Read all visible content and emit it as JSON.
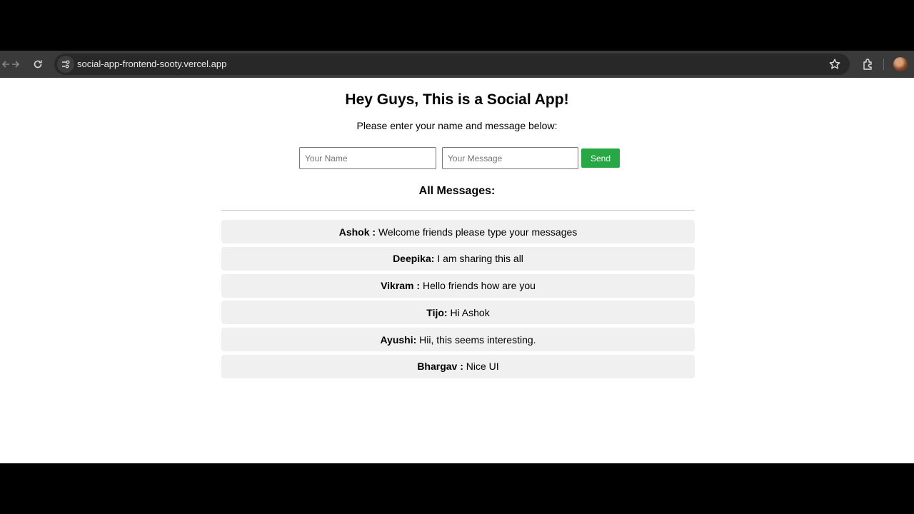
{
  "browser": {
    "url": "social-app-frontend-sooty.vercel.app"
  },
  "page": {
    "title": "Hey Guys, This is a Social App!",
    "subtitle": "Please enter your name and message below:",
    "name_placeholder": "Your Name",
    "message_placeholder": "Your Message",
    "send_label": "Send",
    "messages_heading": "All Messages:"
  },
  "messages": [
    {
      "name": "Ashok :",
      "text": "Welcome friends please type your messages"
    },
    {
      "name": "Deepika:",
      "text": "I am sharing this all"
    },
    {
      "name": "Vikram :",
      "text": "Hello friends how are you"
    },
    {
      "name": "Tijo:",
      "text": "Hi Ashok"
    },
    {
      "name": "Ayushi:",
      "text": "Hii, this seems interesting."
    },
    {
      "name": "Bhargav :",
      "text": "Nice UI"
    }
  ],
  "colors": {
    "send_button": "#28a745",
    "message_background": "#f0f0f0",
    "browser_toolbar": "#3a3a3a"
  },
  "icons": [
    "forward-arrow-icon",
    "reload-icon",
    "site-info-icon",
    "star-icon",
    "extensions-icon",
    "profile-avatar"
  ]
}
